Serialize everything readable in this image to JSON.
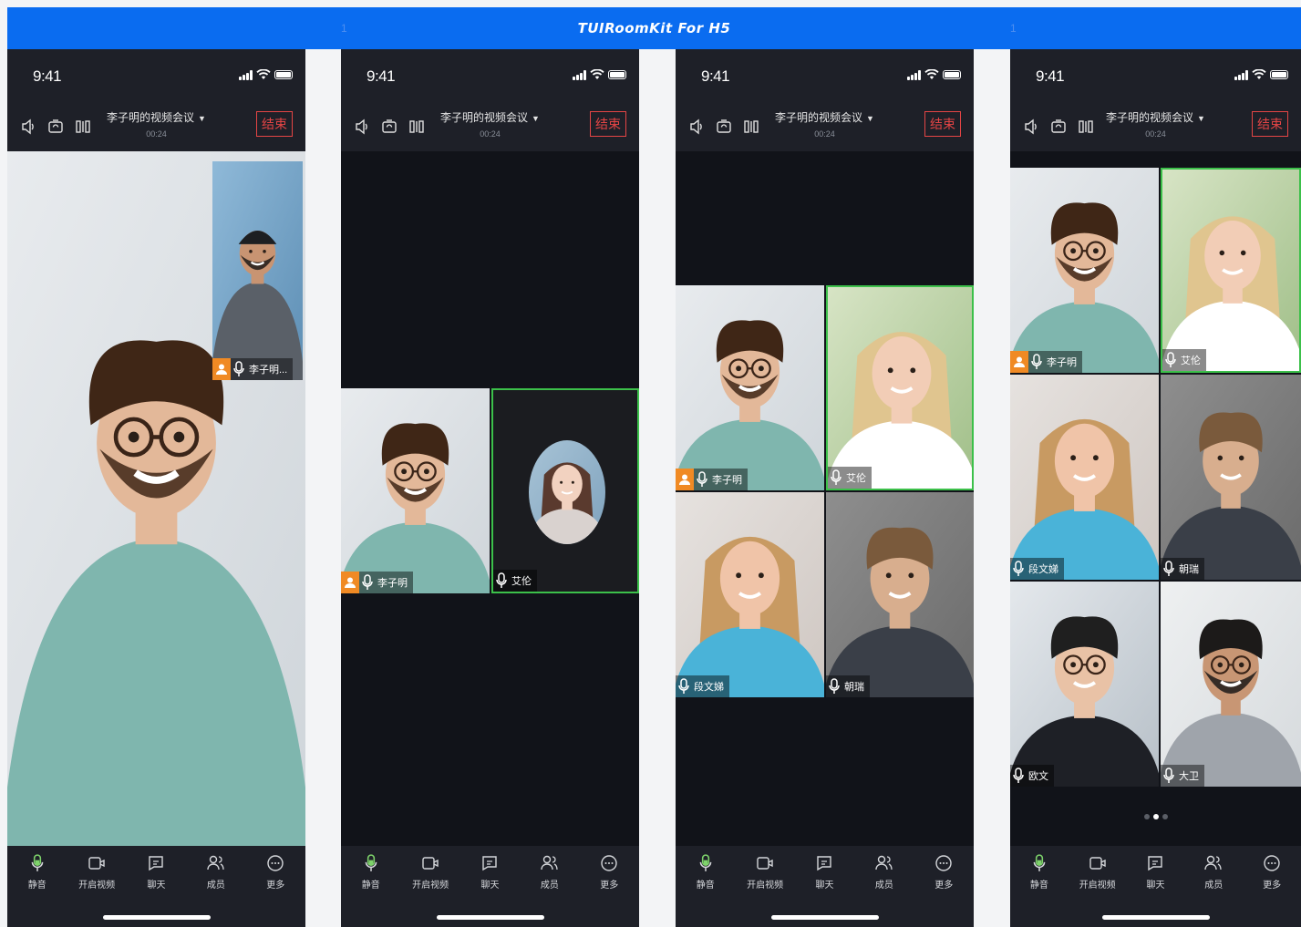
{
  "banner": {
    "title": "TUIRoomKit For H5",
    "marks": [
      "1",
      "1"
    ]
  },
  "status": {
    "time": "9:41"
  },
  "room": {
    "title": "李子明的视频会议",
    "timer": "00:24",
    "end_label": "结束"
  },
  "bottom": {
    "items": [
      {
        "icon": "mic-icon",
        "label": "静音"
      },
      {
        "icon": "camera-icon",
        "label": "开启视频"
      },
      {
        "icon": "chat-icon",
        "label": "聊天"
      },
      {
        "icon": "members-icon",
        "label": "成员"
      },
      {
        "icon": "more-icon",
        "label": "更多"
      }
    ]
  },
  "screens": [
    {
      "layout": "speaker",
      "tiles": [
        {
          "name": "李子明...",
          "host": true
        }
      ]
    },
    {
      "layout": "two",
      "tiles": [
        {
          "name": "李子明",
          "host": true
        },
        {
          "name": "艾伦",
          "host": false,
          "active": true
        }
      ]
    },
    {
      "layout": "four",
      "tiles": [
        {
          "name": "李子明",
          "host": true
        },
        {
          "name": "艾伦",
          "active": true
        },
        {
          "name": "段文娣"
        },
        {
          "name": "朝瑞"
        }
      ]
    },
    {
      "layout": "six",
      "tiles": [
        {
          "name": "李子明",
          "host": true
        },
        {
          "name": "艾伦",
          "active": true
        },
        {
          "name": "段文娣"
        },
        {
          "name": "朝瑞"
        },
        {
          "name": "欧文"
        },
        {
          "name": "大卫"
        }
      ]
    }
  ],
  "colors": {
    "accent": "#0a6cf0",
    "end": "#e54545",
    "active_border": "#3cc04a",
    "host_badge": "#f08a24"
  }
}
